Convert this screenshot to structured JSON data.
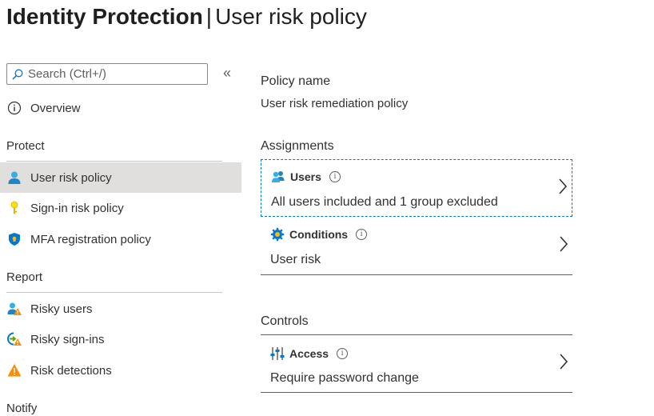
{
  "header": {
    "title_bold": "Identity Protection",
    "separator": "|",
    "title_sub": "User risk policy"
  },
  "sidebar": {
    "search": {
      "placeholder": "Search (Ctrl+/)"
    },
    "collapse_glyph": "«",
    "overview": {
      "label": "Overview",
      "icon": "info-icon"
    },
    "sections": [
      {
        "heading": "Protect",
        "items": [
          {
            "label": "User risk policy",
            "icon": "user-icon",
            "selected": true
          },
          {
            "label": "Sign-in risk policy",
            "icon": "key-icon",
            "selected": false
          },
          {
            "label": "MFA registration policy",
            "icon": "shield-icon",
            "selected": false
          }
        ]
      },
      {
        "heading": "Report",
        "items": [
          {
            "label": "Risky users",
            "icon": "risky-user-icon"
          },
          {
            "label": "Risky sign-ins",
            "icon": "risky-signin-icon"
          },
          {
            "label": "Risk detections",
            "icon": "warning-icon"
          }
        ]
      },
      {
        "heading": "Notify"
      }
    ]
  },
  "main": {
    "policy_name_label": "Policy name",
    "policy_name_value": "User risk remediation policy",
    "assignments_heading": "Assignments",
    "users": {
      "title": "Users",
      "value": "All users included and 1 group excluded",
      "info": "i"
    },
    "conditions": {
      "title": "Conditions",
      "value": "User risk",
      "info": "i"
    },
    "controls_heading": "Controls",
    "access": {
      "title": "Access",
      "value": "Require password change",
      "info": "i"
    }
  },
  "colors": {
    "accent": "#0078d4",
    "selected_bg": "#e1dfdd",
    "warning": "#ff8c00",
    "key": "#fce100"
  }
}
